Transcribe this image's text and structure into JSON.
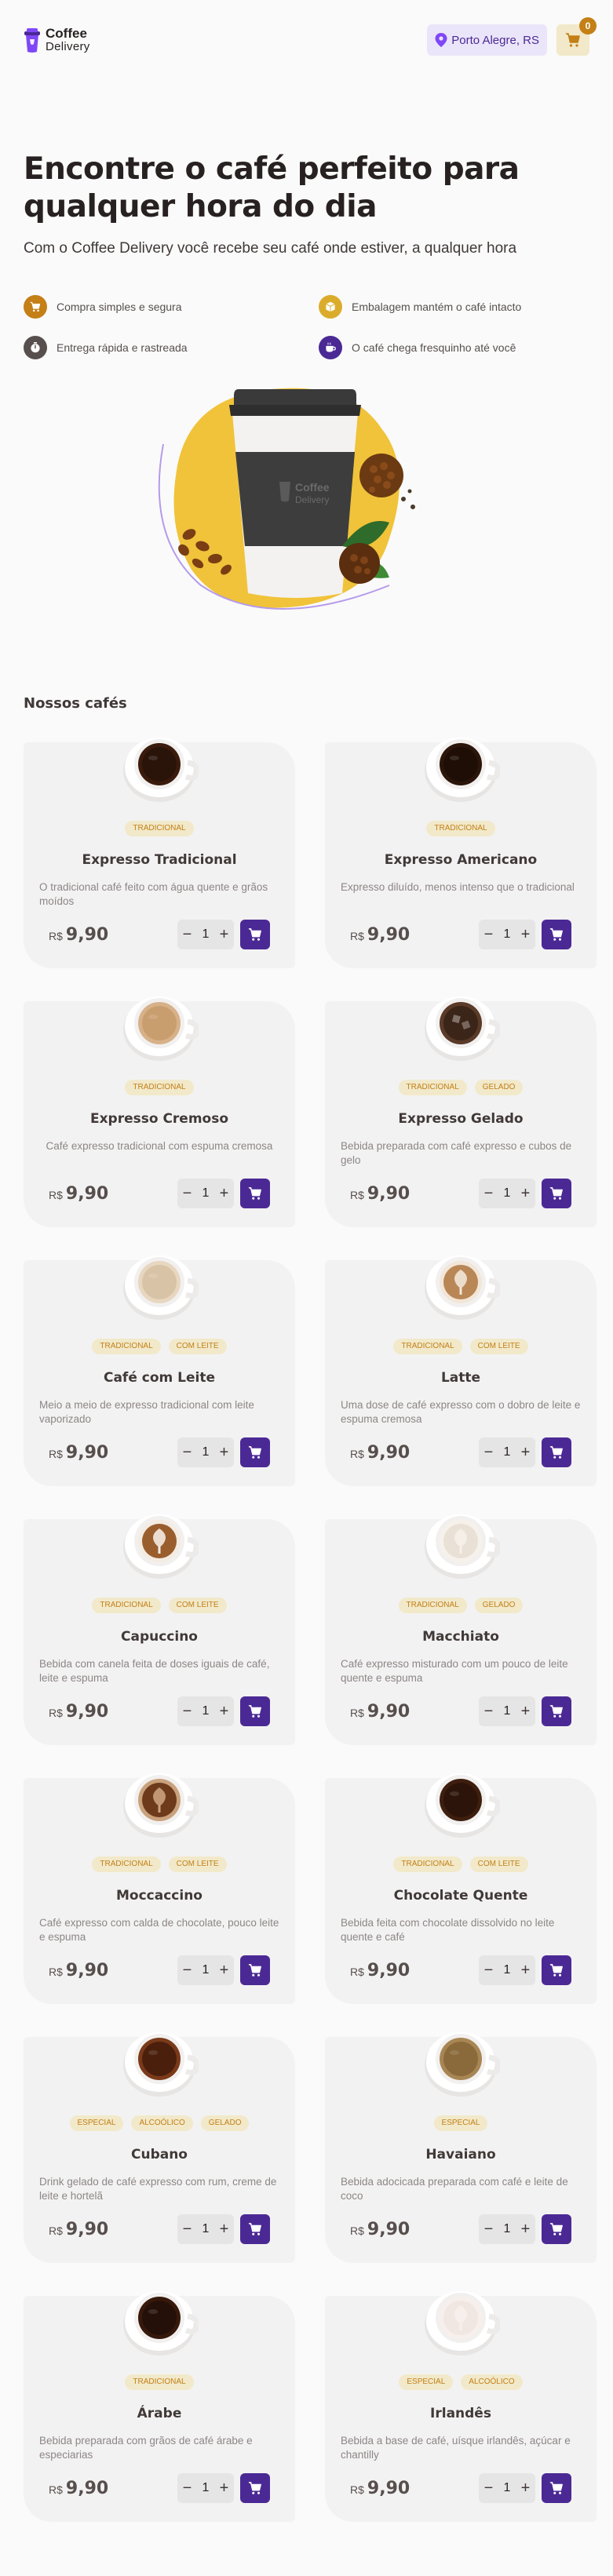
{
  "header": {
    "logo_line1": "Coffee",
    "logo_line2": "Delivery",
    "location": "Porto Alegre, RS",
    "cart_count": "0"
  },
  "hero": {
    "title": "Encontre o café perfeito para qualquer hora do dia",
    "subtitle": "Com o Coffee Delivery você recebe seu café onde estiver, a qualquer hora",
    "benefits": [
      {
        "label": "Compra simples e segura",
        "icon": "cart-icon",
        "color": "#C47F17"
      },
      {
        "label": "Embalagem mantém o café intacto",
        "icon": "package-icon",
        "color": "#DBAC2C"
      },
      {
        "label": "Entrega rápida e rastreada",
        "icon": "timer-icon",
        "color": "#574F4D"
      },
      {
        "label": "O café chega fresquinho até você",
        "icon": "coffee-icon",
        "color": "#4B2995"
      }
    ],
    "cup_brand_line1": "Coffee",
    "cup_brand_line2": "Delivery"
  },
  "section_title": "Nossos cafés",
  "currency": "R$",
  "colors": {
    "brand_purple": "#4B2995",
    "brand_yellow": "#DBAC2C",
    "tag_text": "#C47F17",
    "card_bg": "#F3F2F2"
  },
  "coffees": [
    {
      "name": "Expresso Tradicional",
      "tags": [
        "TRADICIONAL"
      ],
      "desc": "O tradicional café feito com água quente e grãos moídos",
      "price": "9,90",
      "qty": "1",
      "style": "espresso"
    },
    {
      "name": "Expresso Americano",
      "tags": [
        "TRADICIONAL"
      ],
      "desc": "Expresso diluído, menos intenso que o tradicional",
      "price": "9,90",
      "qty": "1",
      "style": "americano"
    },
    {
      "name": "Expresso Cremoso",
      "tags": [
        "TRADICIONAL"
      ],
      "desc": "Café expresso tradicional com espuma cremosa",
      "price": "9,90",
      "qty": "1",
      "style": "cremoso"
    },
    {
      "name": "Expresso Gelado",
      "tags": [
        "TRADICIONAL",
        "GELADO"
      ],
      "desc": "Bebida preparada com café expresso e cubos de gelo",
      "price": "9,90",
      "qty": "1",
      "style": "gelado"
    },
    {
      "name": "Café com Leite",
      "tags": [
        "TRADICIONAL",
        "COM LEITE"
      ],
      "desc": "Meio a meio de expresso tradicional com leite vaporizado",
      "price": "9,90",
      "qty": "1",
      "style": "leite"
    },
    {
      "name": "Latte",
      "tags": [
        "TRADICIONAL",
        "COM LEITE"
      ],
      "desc": "Uma dose de café expresso com o dobro de leite e espuma cremosa",
      "price": "9,90",
      "qty": "1",
      "style": "latte"
    },
    {
      "name": "Capuccino",
      "tags": [
        "TRADICIONAL",
        "COM LEITE"
      ],
      "desc": "Bebida com canela feita de doses iguais de café, leite e espuma",
      "price": "9,90",
      "qty": "1",
      "style": "capuccino"
    },
    {
      "name": "Macchiato",
      "tags": [
        "TRADICIONAL",
        "GELADO"
      ],
      "desc": "Café expresso misturado com um pouco de leite quente e espuma",
      "price": "9,90",
      "qty": "1",
      "style": "macchiato"
    },
    {
      "name": "Moccaccino",
      "tags": [
        "TRADICIONAL",
        "COM LEITE"
      ],
      "desc": "Café expresso com calda de chocolate, pouco leite e espuma",
      "price": "9,90",
      "qty": "1",
      "style": "mocca"
    },
    {
      "name": "Chocolate Quente",
      "tags": [
        "TRADICIONAL",
        "COM LEITE"
      ],
      "desc": "Bebida feita com chocolate dissolvido no leite quente e café",
      "price": "9,90",
      "qty": "1",
      "style": "chocolate"
    },
    {
      "name": "Cubano",
      "tags": [
        "ESPECIAL",
        "ALCOÓLICO",
        "GELADO"
      ],
      "desc": "Drink gelado de café expresso com rum, creme de leite e hortelã",
      "price": "9,90",
      "qty": "1",
      "style": "cubano"
    },
    {
      "name": "Havaiano",
      "tags": [
        "ESPECIAL"
      ],
      "desc": "Bebida adocicada preparada com café e leite de coco",
      "price": "9,90",
      "qty": "1",
      "style": "havaiano"
    },
    {
      "name": "Árabe",
      "tags": [
        "TRADICIONAL"
      ],
      "desc": "Bebida preparada com grãos de café árabe e especiarias",
      "price": "9,90",
      "qty": "1",
      "style": "arabe"
    },
    {
      "name": "Irlandês",
      "tags": [
        "ESPECIAL",
        "ALCOÓLICO"
      ],
      "desc": "Bebida a base de café, uísque irlandês, açúcar e chantilly",
      "price": "9,90",
      "qty": "1",
      "style": "irlandes"
    }
  ]
}
